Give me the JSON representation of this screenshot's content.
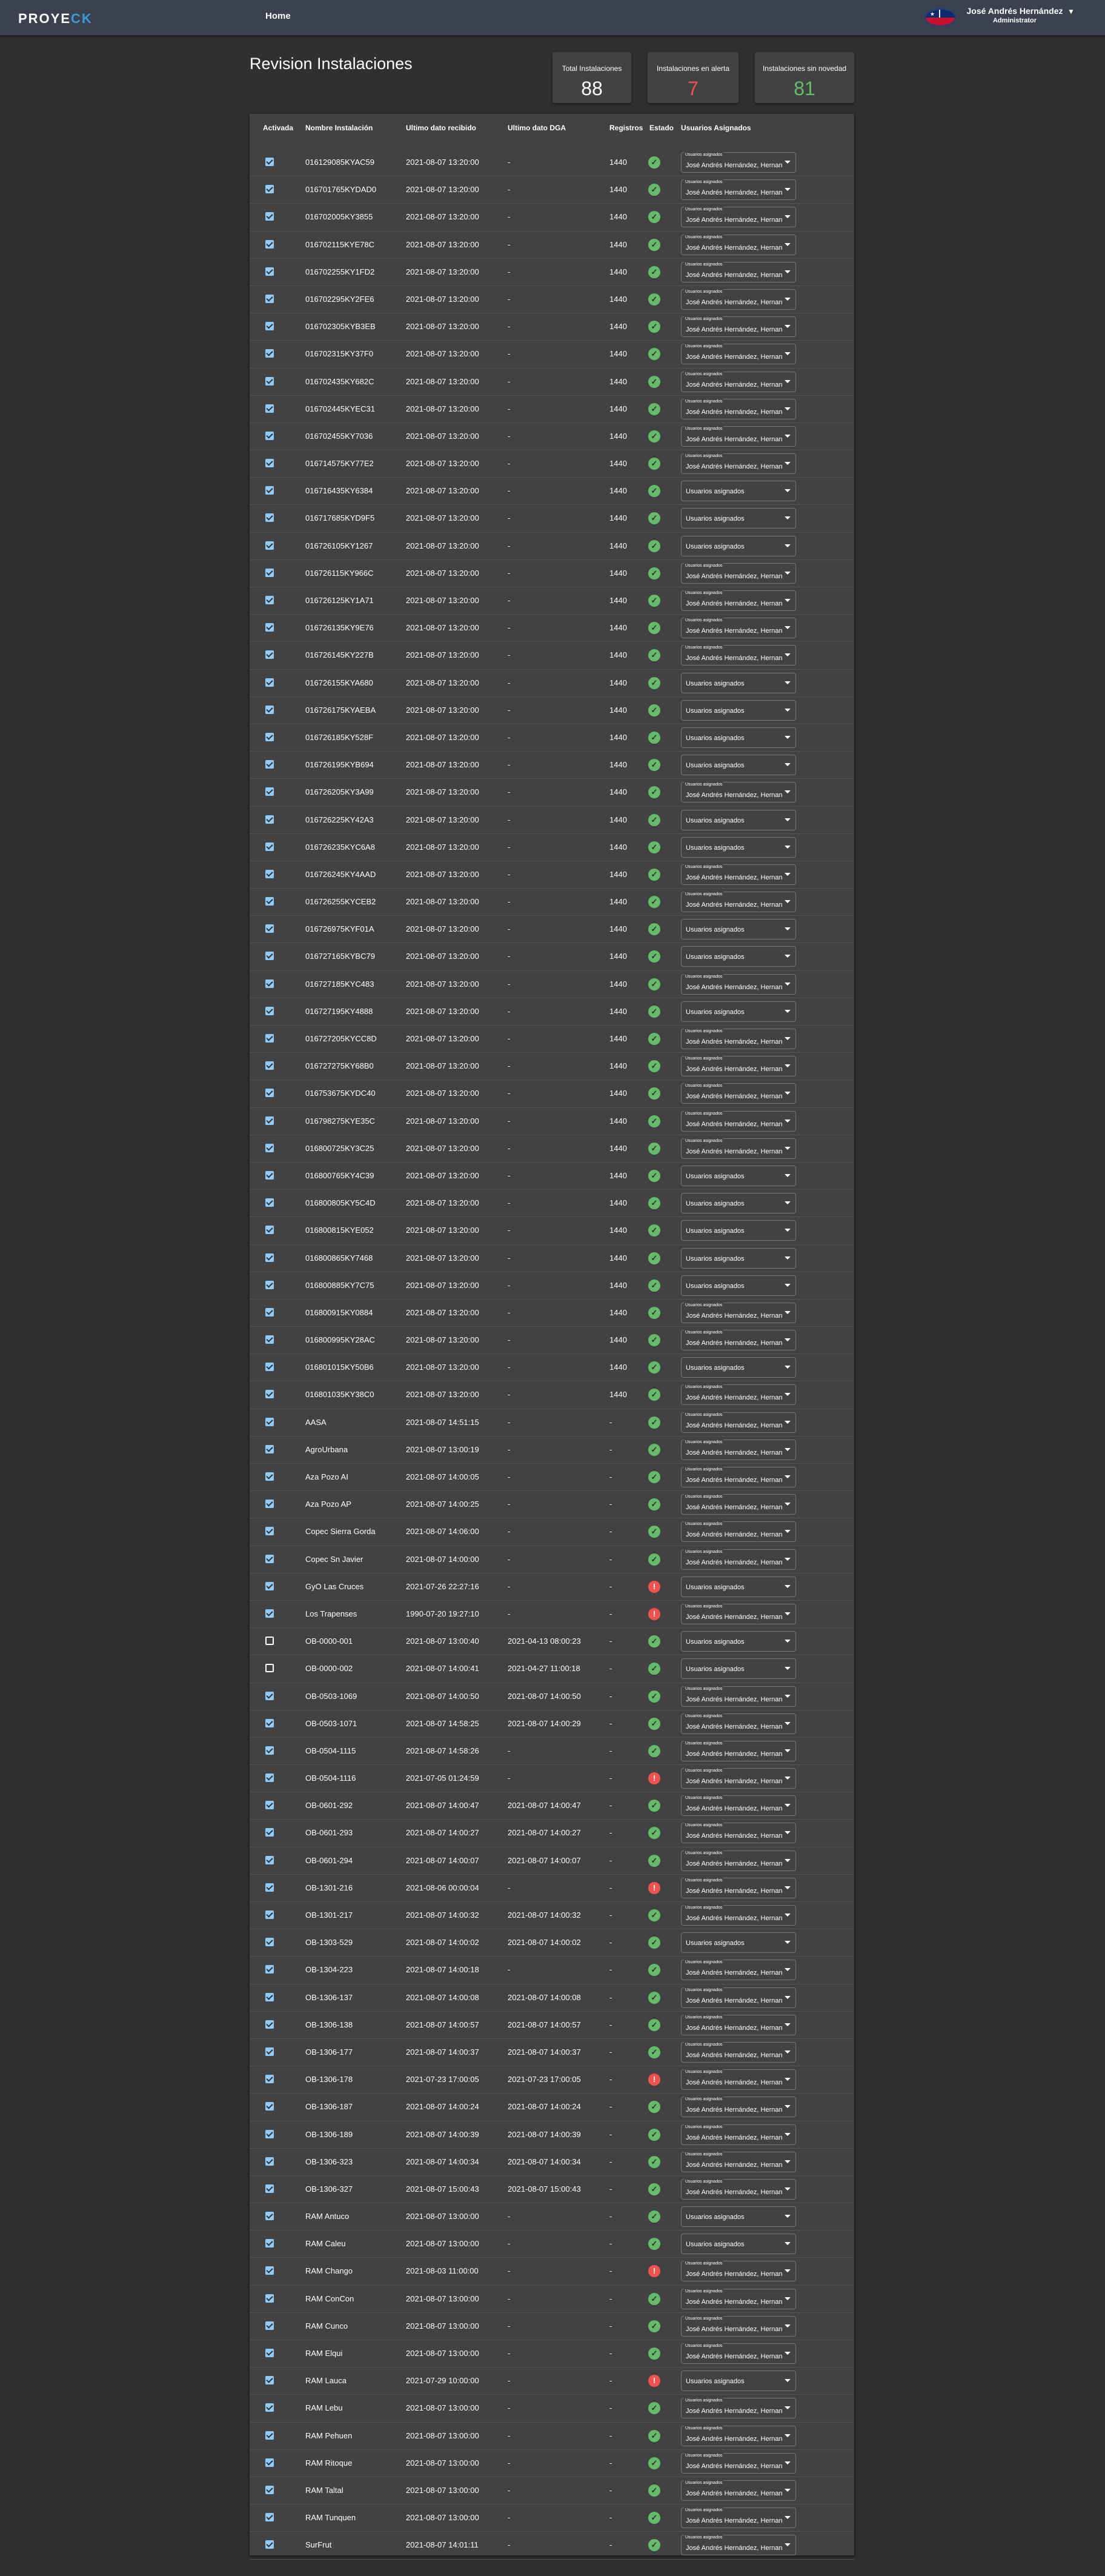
{
  "app": {
    "logo_main": "PROYE",
    "logo_accent": "CK",
    "home": "Home",
    "flag_icon": "chile-flag-icon"
  },
  "user": {
    "name": "José Andrés Hernández",
    "role": "Administrator"
  },
  "page": {
    "title": "Revision Instalaciones"
  },
  "stats": [
    {
      "label": "Total Instalaciones",
      "value": "88",
      "color": "#ffffff"
    },
    {
      "label": "Instalaciones en alerta",
      "value": "7",
      "color": "#ef5350"
    },
    {
      "label": "Instalaciones sin novedad",
      "value": "81",
      "color": "#66bb6a"
    }
  ],
  "table": {
    "headers": [
      "Activada",
      "Nombre Instalación",
      "Ultimo dato recibido",
      "Ultimo dato DGA",
      "Registros",
      "Estado",
      "Usuarios Asignados"
    ],
    "select_float_label": "Usuarios asignados",
    "select_placeholder": "Usuarios asignados",
    "select_filled_value": "José Andrés Hernández, Hernan C",
    "rows": [
      {
        "checked": true,
        "name": "016129085KYAC59",
        "last": "2021-08-07 13:20:00",
        "dga": "-",
        "reg": "1440",
        "ok": true,
        "filled": true
      },
      {
        "checked": true,
        "name": "016701765KYDAD0",
        "last": "2021-08-07 13:20:00",
        "dga": "-",
        "reg": "1440",
        "ok": true,
        "filled": true
      },
      {
        "checked": true,
        "name": "016702005KY3855",
        "last": "2021-08-07 13:20:00",
        "dga": "-",
        "reg": "1440",
        "ok": true,
        "filled": true
      },
      {
        "checked": true,
        "name": "016702115KYE78C",
        "last": "2021-08-07 13:20:00",
        "dga": "-",
        "reg": "1440",
        "ok": true,
        "filled": true
      },
      {
        "checked": true,
        "name": "016702255KY1FD2",
        "last": "2021-08-07 13:20:00",
        "dga": "-",
        "reg": "1440",
        "ok": true,
        "filled": true
      },
      {
        "checked": true,
        "name": "016702295KY2FE6",
        "last": "2021-08-07 13:20:00",
        "dga": "-",
        "reg": "1440",
        "ok": true,
        "filled": true
      },
      {
        "checked": true,
        "name": "016702305KYB3EB",
        "last": "2021-08-07 13:20:00",
        "dga": "-",
        "reg": "1440",
        "ok": true,
        "filled": true
      },
      {
        "checked": true,
        "name": "016702315KY37F0",
        "last": "2021-08-07 13:20:00",
        "dga": "-",
        "reg": "1440",
        "ok": true,
        "filled": true
      },
      {
        "checked": true,
        "name": "016702435KY682C",
        "last": "2021-08-07 13:20:00",
        "dga": "-",
        "reg": "1440",
        "ok": true,
        "filled": true
      },
      {
        "checked": true,
        "name": "016702445KYEC31",
        "last": "2021-08-07 13:20:00",
        "dga": "-",
        "reg": "1440",
        "ok": true,
        "filled": true
      },
      {
        "checked": true,
        "name": "016702455KY7036",
        "last": "2021-08-07 13:20:00",
        "dga": "-",
        "reg": "1440",
        "ok": true,
        "filled": true
      },
      {
        "checked": true,
        "name": "016714575KY77E2",
        "last": "2021-08-07 13:20:00",
        "dga": "-",
        "reg": "1440",
        "ok": true,
        "filled": true
      },
      {
        "checked": true,
        "name": "016716435KY6384",
        "last": "2021-08-07 13:20:00",
        "dga": "-",
        "reg": "1440",
        "ok": true,
        "filled": false
      },
      {
        "checked": true,
        "name": "016717685KYD9F5",
        "last": "2021-08-07 13:20:00",
        "dga": "-",
        "reg": "1440",
        "ok": true,
        "filled": false
      },
      {
        "checked": true,
        "name": "016726105KY1267",
        "last": "2021-08-07 13:20:00",
        "dga": "-",
        "reg": "1440",
        "ok": true,
        "filled": false
      },
      {
        "checked": true,
        "name": "016726115KY966C",
        "last": "2021-08-07 13:20:00",
        "dga": "-",
        "reg": "1440",
        "ok": true,
        "filled": true
      },
      {
        "checked": true,
        "name": "016726125KY1A71",
        "last": "2021-08-07 13:20:00",
        "dga": "-",
        "reg": "1440",
        "ok": true,
        "filled": true
      },
      {
        "checked": true,
        "name": "016726135KY9E76",
        "last": "2021-08-07 13:20:00",
        "dga": "-",
        "reg": "1440",
        "ok": true,
        "filled": true
      },
      {
        "checked": true,
        "name": "016726145KY227B",
        "last": "2021-08-07 13:20:00",
        "dga": "-",
        "reg": "1440",
        "ok": true,
        "filled": true
      },
      {
        "checked": true,
        "name": "016726155KYA680",
        "last": "2021-08-07 13:20:00",
        "dga": "-",
        "reg": "1440",
        "ok": true,
        "filled": false
      },
      {
        "checked": true,
        "name": "016726175KYAEBA",
        "last": "2021-08-07 13:20:00",
        "dga": "-",
        "reg": "1440",
        "ok": true,
        "filled": false
      },
      {
        "checked": true,
        "name": "016726185KY528F",
        "last": "2021-08-07 13:20:00",
        "dga": "-",
        "reg": "1440",
        "ok": true,
        "filled": false
      },
      {
        "checked": true,
        "name": "016726195KYB694",
        "last": "2021-08-07 13:20:00",
        "dga": "-",
        "reg": "1440",
        "ok": true,
        "filled": false
      },
      {
        "checked": true,
        "name": "016726205KY3A99",
        "last": "2021-08-07 13:20:00",
        "dga": "-",
        "reg": "1440",
        "ok": true,
        "filled": true
      },
      {
        "checked": true,
        "name": "016726225KY42A3",
        "last": "2021-08-07 13:20:00",
        "dga": "-",
        "reg": "1440",
        "ok": true,
        "filled": false
      },
      {
        "checked": true,
        "name": "016726235KYC6A8",
        "last": "2021-08-07 13:20:00",
        "dga": "-",
        "reg": "1440",
        "ok": true,
        "filled": false
      },
      {
        "checked": true,
        "name": "016726245KY4AAD",
        "last": "2021-08-07 13:20:00",
        "dga": "-",
        "reg": "1440",
        "ok": true,
        "filled": true
      },
      {
        "checked": true,
        "name": "016726255KYCEB2",
        "last": "2021-08-07 13:20:00",
        "dga": "-",
        "reg": "1440",
        "ok": true,
        "filled": true
      },
      {
        "checked": true,
        "name": "016726975KYF01A",
        "last": "2021-08-07 13:20:00",
        "dga": "-",
        "reg": "1440",
        "ok": true,
        "filled": false
      },
      {
        "checked": true,
        "name": "016727165KYBC79",
        "last": "2021-08-07 13:20:00",
        "dga": "-",
        "reg": "1440",
        "ok": true,
        "filled": false
      },
      {
        "checked": true,
        "name": "016727185KYC483",
        "last": "2021-08-07 13:20:00",
        "dga": "-",
        "reg": "1440",
        "ok": true,
        "filled": true
      },
      {
        "checked": true,
        "name": "016727195KY4888",
        "last": "2021-08-07 13:20:00",
        "dga": "-",
        "reg": "1440",
        "ok": true,
        "filled": false
      },
      {
        "checked": true,
        "name": "016727205KYCC8D",
        "last": "2021-08-07 13:20:00",
        "dga": "-",
        "reg": "1440",
        "ok": true,
        "filled": true
      },
      {
        "checked": true,
        "name": "016727275KY68B0",
        "last": "2021-08-07 13:20:00",
        "dga": "-",
        "reg": "1440",
        "ok": true,
        "filled": true
      },
      {
        "checked": true,
        "name": "016753675KYDC40",
        "last": "2021-08-07 13:20:00",
        "dga": "-",
        "reg": "1440",
        "ok": true,
        "filled": true
      },
      {
        "checked": true,
        "name": "016798275KYE35C",
        "last": "2021-08-07 13:20:00",
        "dga": "-",
        "reg": "1440",
        "ok": true,
        "filled": true
      },
      {
        "checked": true,
        "name": "016800725KY3C25",
        "last": "2021-08-07 13:20:00",
        "dga": "-",
        "reg": "1440",
        "ok": true,
        "filled": true
      },
      {
        "checked": true,
        "name": "016800765KY4C39",
        "last": "2021-08-07 13:20:00",
        "dga": "-",
        "reg": "1440",
        "ok": true,
        "filled": false
      },
      {
        "checked": true,
        "name": "016800805KY5C4D",
        "last": "2021-08-07 13:20:00",
        "dga": "-",
        "reg": "1440",
        "ok": true,
        "filled": false
      },
      {
        "checked": true,
        "name": "016800815KYE052",
        "last": "2021-08-07 13:20:00",
        "dga": "-",
        "reg": "1440",
        "ok": true,
        "filled": false
      },
      {
        "checked": true,
        "name": "016800865KY7468",
        "last": "2021-08-07 13:20:00",
        "dga": "-",
        "reg": "1440",
        "ok": true,
        "filled": false
      },
      {
        "checked": true,
        "name": "016800885KY7C75",
        "last": "2021-08-07 13:20:00",
        "dga": "-",
        "reg": "1440",
        "ok": true,
        "filled": false
      },
      {
        "checked": true,
        "name": "016800915KY0884",
        "last": "2021-08-07 13:20:00",
        "dga": "-",
        "reg": "1440",
        "ok": true,
        "filled": true
      },
      {
        "checked": true,
        "name": "016800995KY28AC",
        "last": "2021-08-07 13:20:00",
        "dga": "-",
        "reg": "1440",
        "ok": true,
        "filled": true
      },
      {
        "checked": true,
        "name": "016801015KY50B6",
        "last": "2021-08-07 13:20:00",
        "dga": "-",
        "reg": "1440",
        "ok": true,
        "filled": false
      },
      {
        "checked": true,
        "name": "016801035KY38C0",
        "last": "2021-08-07 13:20:00",
        "dga": "-",
        "reg": "1440",
        "ok": true,
        "filled": true
      },
      {
        "checked": true,
        "name": "AASA",
        "last": "2021-08-07 14:51:15",
        "dga": "-",
        "reg": "-",
        "ok": true,
        "filled": true
      },
      {
        "checked": true,
        "name": "AgroUrbana",
        "last": "2021-08-07 13:00:19",
        "dga": "-",
        "reg": "-",
        "ok": true,
        "filled": true
      },
      {
        "checked": true,
        "name": "Aza Pozo AI",
        "last": "2021-08-07 14:00:05",
        "dga": "-",
        "reg": "-",
        "ok": true,
        "filled": true
      },
      {
        "checked": true,
        "name": "Aza Pozo AP",
        "last": "2021-08-07 14:00:25",
        "dga": "-",
        "reg": "-",
        "ok": true,
        "filled": true
      },
      {
        "checked": true,
        "name": "Copec Sierra Gorda",
        "last": "2021-08-07 14:06:00",
        "dga": "-",
        "reg": "-",
        "ok": true,
        "filled": true
      },
      {
        "checked": true,
        "name": "Copec Sn Javier",
        "last": "2021-08-07 14:00:00",
        "dga": "-",
        "reg": "-",
        "ok": true,
        "filled": true
      },
      {
        "checked": true,
        "name": "GyO Las Cruces",
        "last": "2021-07-26 22:27:16",
        "dga": "-",
        "reg": "-",
        "ok": false,
        "filled": false
      },
      {
        "checked": true,
        "name": "Los Trapenses",
        "last": "1990-07-20 19:27:10",
        "dga": "-",
        "reg": "-",
        "ok": false,
        "filled": true
      },
      {
        "checked": false,
        "name": "OB-0000-001",
        "last": "2021-08-07 13:00:40",
        "dga": "2021-04-13 08:00:23",
        "reg": "-",
        "ok": true,
        "filled": false
      },
      {
        "checked": false,
        "name": "OB-0000-002",
        "last": "2021-08-07 14:00:41",
        "dga": "2021-04-27 11:00:18",
        "reg": "-",
        "ok": true,
        "filled": false
      },
      {
        "checked": true,
        "name": "OB-0503-1069",
        "last": "2021-08-07 14:00:50",
        "dga": "2021-08-07 14:00:50",
        "reg": "-",
        "ok": true,
        "filled": true
      },
      {
        "checked": true,
        "name": "OB-0503-1071",
        "last": "2021-08-07 14:58:25",
        "dga": "2021-08-07 14:00:29",
        "reg": "-",
        "ok": true,
        "filled": true
      },
      {
        "checked": true,
        "name": "OB-0504-1115",
        "last": "2021-08-07 14:58:26",
        "dga": "-",
        "reg": "-",
        "ok": true,
        "filled": true
      },
      {
        "checked": true,
        "name": "OB-0504-1116",
        "last": "2021-07-05 01:24:59",
        "dga": "-",
        "reg": "-",
        "ok": false,
        "filled": true
      },
      {
        "checked": true,
        "name": "OB-0601-292",
        "last": "2021-08-07 14:00:47",
        "dga": "2021-08-07 14:00:47",
        "reg": "-",
        "ok": true,
        "filled": true
      },
      {
        "checked": true,
        "name": "OB-0601-293",
        "last": "2021-08-07 14:00:27",
        "dga": "2021-08-07 14:00:27",
        "reg": "-",
        "ok": true,
        "filled": true
      },
      {
        "checked": true,
        "name": "OB-0601-294",
        "last": "2021-08-07 14:00:07",
        "dga": "2021-08-07 14:00:07",
        "reg": "-",
        "ok": true,
        "filled": true
      },
      {
        "checked": true,
        "name": "OB-1301-216",
        "last": "2021-08-06 00:00:04",
        "dga": "-",
        "reg": "-",
        "ok": false,
        "filled": true
      },
      {
        "checked": true,
        "name": "OB-1301-217",
        "last": "2021-08-07 14:00:32",
        "dga": "2021-08-07 14:00:32",
        "reg": "-",
        "ok": true,
        "filled": true
      },
      {
        "checked": true,
        "name": "OB-1303-529",
        "last": "2021-08-07 14:00:02",
        "dga": "2021-08-07 14:00:02",
        "reg": "-",
        "ok": true,
        "filled": false
      },
      {
        "checked": true,
        "name": "OB-1304-223",
        "last": "2021-08-07 14:00:18",
        "dga": "-",
        "reg": "-",
        "ok": true,
        "filled": true
      },
      {
        "checked": true,
        "name": "OB-1306-137",
        "last": "2021-08-07 14:00:08",
        "dga": "2021-08-07 14:00:08",
        "reg": "-",
        "ok": true,
        "filled": true
      },
      {
        "checked": true,
        "name": "OB-1306-138",
        "last": "2021-08-07 14:00:57",
        "dga": "2021-08-07 14:00:57",
        "reg": "-",
        "ok": true,
        "filled": true
      },
      {
        "checked": true,
        "name": "OB-1306-177",
        "last": "2021-08-07 14:00:37",
        "dga": "2021-08-07 14:00:37",
        "reg": "-",
        "ok": true,
        "filled": true
      },
      {
        "checked": true,
        "name": "OB-1306-178",
        "last": "2021-07-23 17:00:05",
        "dga": "2021-07-23 17:00:05",
        "reg": "-",
        "ok": false,
        "filled": true
      },
      {
        "checked": true,
        "name": "OB-1306-187",
        "last": "2021-08-07 14:00:24",
        "dga": "2021-08-07 14:00:24",
        "reg": "-",
        "ok": true,
        "filled": true
      },
      {
        "checked": true,
        "name": "OB-1306-189",
        "last": "2021-08-07 14:00:39",
        "dga": "2021-08-07 14:00:39",
        "reg": "-",
        "ok": true,
        "filled": true
      },
      {
        "checked": true,
        "name": "OB-1306-323",
        "last": "2021-08-07 14:00:34",
        "dga": "2021-08-07 14:00:34",
        "reg": "-",
        "ok": true,
        "filled": true
      },
      {
        "checked": true,
        "name": "OB-1306-327",
        "last": "2021-08-07 15:00:43",
        "dga": "2021-08-07 15:00:43",
        "reg": "-",
        "ok": true,
        "filled": true
      },
      {
        "checked": true,
        "name": "RAM Antuco",
        "last": "2021-08-07 13:00:00",
        "dga": "-",
        "reg": "-",
        "ok": true,
        "filled": false
      },
      {
        "checked": true,
        "name": "RAM Caleu",
        "last": "2021-08-07 13:00:00",
        "dga": "-",
        "reg": "-",
        "ok": true,
        "filled": false
      },
      {
        "checked": true,
        "name": "RAM Chango",
        "last": "2021-08-03 11:00:00",
        "dga": "-",
        "reg": "-",
        "ok": false,
        "filled": true
      },
      {
        "checked": true,
        "name": "RAM ConCon",
        "last": "2021-08-07 13:00:00",
        "dga": "-",
        "reg": "-",
        "ok": true,
        "filled": true
      },
      {
        "checked": true,
        "name": "RAM Cunco",
        "last": "2021-08-07 13:00:00",
        "dga": "-",
        "reg": "-",
        "ok": true,
        "filled": true
      },
      {
        "checked": true,
        "name": "RAM Elqui",
        "last": "2021-08-07 13:00:00",
        "dga": "-",
        "reg": "-",
        "ok": true,
        "filled": true
      },
      {
        "checked": true,
        "name": "RAM Lauca",
        "last": "2021-07-29 10:00:00",
        "dga": "-",
        "reg": "-",
        "ok": false,
        "filled": false
      },
      {
        "checked": true,
        "name": "RAM Lebu",
        "last": "2021-08-07 13:00:00",
        "dga": "-",
        "reg": "-",
        "ok": true,
        "filled": true
      },
      {
        "checked": true,
        "name": "RAM Pehuen",
        "last": "2021-08-07 13:00:00",
        "dga": "-",
        "reg": "-",
        "ok": true,
        "filled": true
      },
      {
        "checked": true,
        "name": "RAM Ritoque",
        "last": "2021-08-07 13:00:00",
        "dga": "-",
        "reg": "-",
        "ok": true,
        "filled": true
      },
      {
        "checked": true,
        "name": "RAM Taltal",
        "last": "2021-08-07 13:00:00",
        "dga": "-",
        "reg": "-",
        "ok": true,
        "filled": true
      },
      {
        "checked": true,
        "name": "RAM Tunquen",
        "last": "2021-08-07 13:00:00",
        "dga": "-",
        "reg": "-",
        "ok": true,
        "filled": true
      },
      {
        "checked": true,
        "name": "SurFrut",
        "last": "2021-08-07 14:01:11",
        "dga": "-",
        "reg": "-",
        "ok": true,
        "filled": true
      }
    ]
  }
}
